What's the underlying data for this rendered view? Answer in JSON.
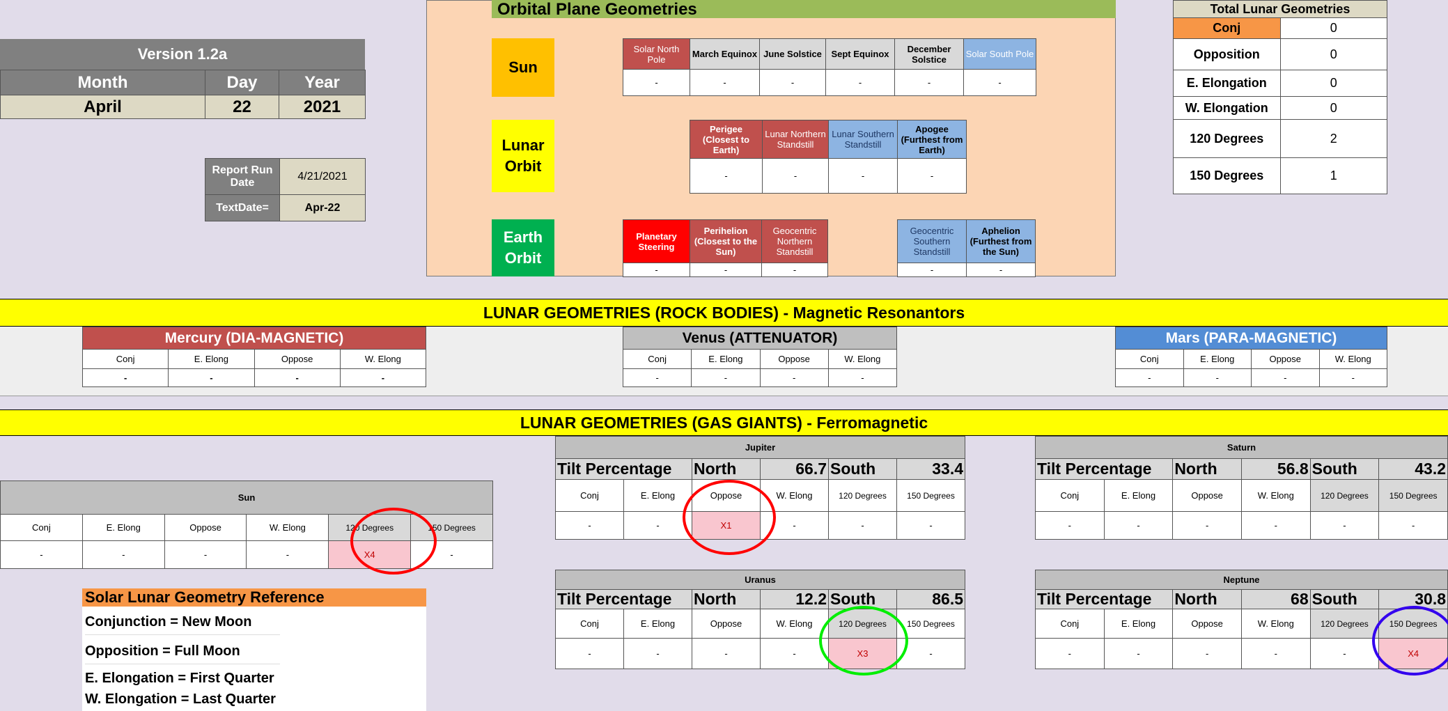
{
  "version": "Version 1.2a",
  "date": {
    "month_label": "Month",
    "day_label": "Day",
    "year_label": "Year",
    "month": "April",
    "day": "22",
    "year": "2021"
  },
  "report": {
    "run_label": "Report Run Date",
    "run_value": "4/21/2021",
    "text_label": "TextDate=",
    "text_value": "Apr-22"
  },
  "orbital": {
    "title": "Orbital Plane Geometries",
    "sun": {
      "label": "Sun",
      "headers": [
        "Solar North Pole",
        "March Equinox",
        "June Solstice",
        "Sept Equinox",
        "December Solstice",
        "Solar South Pole"
      ],
      "values": [
        "-",
        "-",
        "-",
        "-",
        "-",
        "-"
      ]
    },
    "lunar": {
      "label": "Lunar Orbit",
      "headers": [
        "Perigee (Closest to Earth)",
        "Lunar Northern Standstill",
        "Lunar Southern Standstill",
        "Apogee (Furthest from Earth)"
      ],
      "values": [
        "-",
        "-",
        "-",
        "-"
      ]
    },
    "earth": {
      "label": "Earth Orbit",
      "headers_left": [
        "Planetary Steering",
        "Perihelion (Closest to the Sun)",
        "Geocentric Northern Standstill"
      ],
      "headers_right": [
        "Geocentric Southern Standstill",
        "Aphelion (Furthest from the Sun)"
      ],
      "values_left": [
        "-",
        "-",
        "-"
      ],
      "values_right": [
        "-",
        "-"
      ]
    }
  },
  "totals": {
    "title": "Total Lunar Geometries",
    "rows": [
      {
        "label": "Conj",
        "value": "0"
      },
      {
        "label": "Opposition",
        "value": "0"
      },
      {
        "label": "E. Elongation",
        "value": "0"
      },
      {
        "label": "W. Elongation",
        "value": "0"
      },
      {
        "label": "120 Degrees",
        "value": "2"
      },
      {
        "label": "150 Degrees",
        "value": "1"
      }
    ]
  },
  "rock": {
    "title": "LUNAR GEOMETRIES (ROCK BODIES) - Magnetic Resonantors",
    "headers": [
      "Conj",
      "E. Elong",
      "Oppose",
      "W. Elong"
    ],
    "mercury": {
      "title": "Mercury (DIA-MAGNETIC)",
      "values": [
        "-",
        "-",
        "-",
        "-"
      ]
    },
    "venus": {
      "title": "Venus (ATTENUATOR)",
      "values": [
        "-",
        "-",
        "-",
        "-"
      ]
    },
    "mars": {
      "title": "Mars (PARA-MAGNETIC)",
      "values": [
        "-",
        "-",
        "-",
        "-"
      ]
    }
  },
  "gas": {
    "title": "LUNAR GEOMETRIES (GAS GIANTS) - Ferromagnetic",
    "headers": [
      "Conj",
      "E. Elong",
      "Oppose",
      "W. Elong",
      "120 Degrees",
      "150 Degrees"
    ],
    "tilt_label": "Tilt Percentage",
    "north_label": "North",
    "south_label": "South",
    "sun": {
      "title": "Sun",
      "values": [
        "-",
        "-",
        "-",
        "-",
        "X4",
        "-"
      ]
    },
    "jupiter": {
      "title": "Jupiter",
      "north": "66.7",
      "south": "33.4",
      "values": [
        "-",
        "-",
        "X1",
        "-",
        "-",
        "-"
      ]
    },
    "saturn": {
      "title": "Saturn",
      "north": "56.8",
      "south": "43.2",
      "values": [
        "-",
        "-",
        "-",
        "-",
        "-",
        "-"
      ]
    },
    "uranus": {
      "title": "Uranus",
      "north": "12.2",
      "south": "86.5",
      "values": [
        "-",
        "-",
        "-",
        "-",
        "X3",
        "-"
      ]
    },
    "neptune": {
      "title": "Neptune",
      "north": "68",
      "south": "30.8",
      "values": [
        "-",
        "-",
        "-",
        "-",
        "-",
        "X4"
      ]
    }
  },
  "reference": {
    "title": "Solar Lunar Geometry Reference",
    "lines": [
      "Conjunction = New Moon",
      "Opposition = Full Moon",
      "E. Elongation = First Quarter",
      "W. Elongation = Last Quarter"
    ]
  },
  "colors": {
    "orange": "#f79646",
    "yellow": "#ffff00",
    "green": "#9bbb59",
    "peach": "#fcd5b4",
    "red": "#c0504d",
    "blue": "#8db4e2",
    "pink": "#f9c6cf"
  }
}
